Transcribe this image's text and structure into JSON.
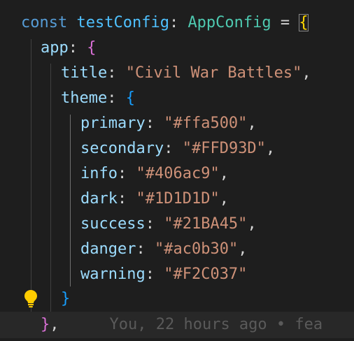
{
  "code": {
    "line1": {
      "keyword": "const",
      "var_name": "testConfig",
      "colon": ":",
      "type_name": "AppConfig",
      "equals": "=",
      "open_brace": "{"
    },
    "line2": {
      "key": "app",
      "colon": ":",
      "open_brace": "{"
    },
    "line3": {
      "key": "title",
      "colon": ":",
      "value": "\"Civil War Battles\"",
      "comma": ","
    },
    "line4": {
      "key": "theme",
      "colon": ":",
      "open_brace": "{"
    },
    "theme_entries": [
      {
        "key": "primary",
        "colon": ":",
        "value": "\"#ffa500\"",
        "comma": ","
      },
      {
        "key": "secondary",
        "colon": ":",
        "value": "\"#FFD93D\"",
        "comma": ","
      },
      {
        "key": "info",
        "colon": ":",
        "value": "\"#406ac9\"",
        "comma": ","
      },
      {
        "key": "dark",
        "colon": ":",
        "value": "\"#1D1D1D\"",
        "comma": ","
      },
      {
        "key": "success",
        "colon": ":",
        "value": "\"#21BA45\"",
        "comma": ","
      },
      {
        "key": "danger",
        "colon": ":",
        "value": "\"#ac0b30\"",
        "comma": ","
      },
      {
        "key": "warning",
        "colon": ":",
        "value": "\"#F2C037\"",
        "comma": ""
      }
    ],
    "close_theme": "}",
    "close_app": "}",
    "close_app_comma": ","
  },
  "git_blame": {
    "text": "You, 22 hours ago • fea"
  },
  "icons": {
    "lightbulb": "lightbulb-icon"
  },
  "colors": {
    "background": "#1e1e1e",
    "keyword": "#569cd6",
    "variable": "#4fc1ff",
    "type": "#4ec9b0",
    "property": "#9cdcfe",
    "string": "#ce9178",
    "brace_level1": "#ffd700",
    "brace_level2": "#da70d6",
    "brace_level3": "#179fff",
    "lightbulb": "#ffcc00"
  }
}
